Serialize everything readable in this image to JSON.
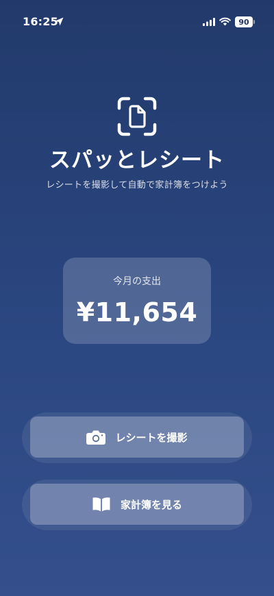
{
  "status_bar": {
    "time": "16:25",
    "battery_level": "90",
    "icons": [
      "location-arrow-icon",
      "cellular-signal-icon",
      "wifi-icon",
      "battery-icon"
    ]
  },
  "header": {
    "icon": "document-scan-icon",
    "title": "スパッとレシート",
    "subtitle": "レシートを撮影して自動で家計簿をつけよう"
  },
  "spend_card": {
    "label": "今月の支出",
    "amount": "¥11,654"
  },
  "actions": {
    "capture": {
      "icon": "camera-icon",
      "label": "レシートを撮影"
    },
    "ledger": {
      "icon": "book-icon",
      "label": "家計簿を見る"
    }
  },
  "colors": {
    "background_top": "#223a6b",
    "background_bottom": "#344f8c",
    "text": "#ffffff"
  }
}
